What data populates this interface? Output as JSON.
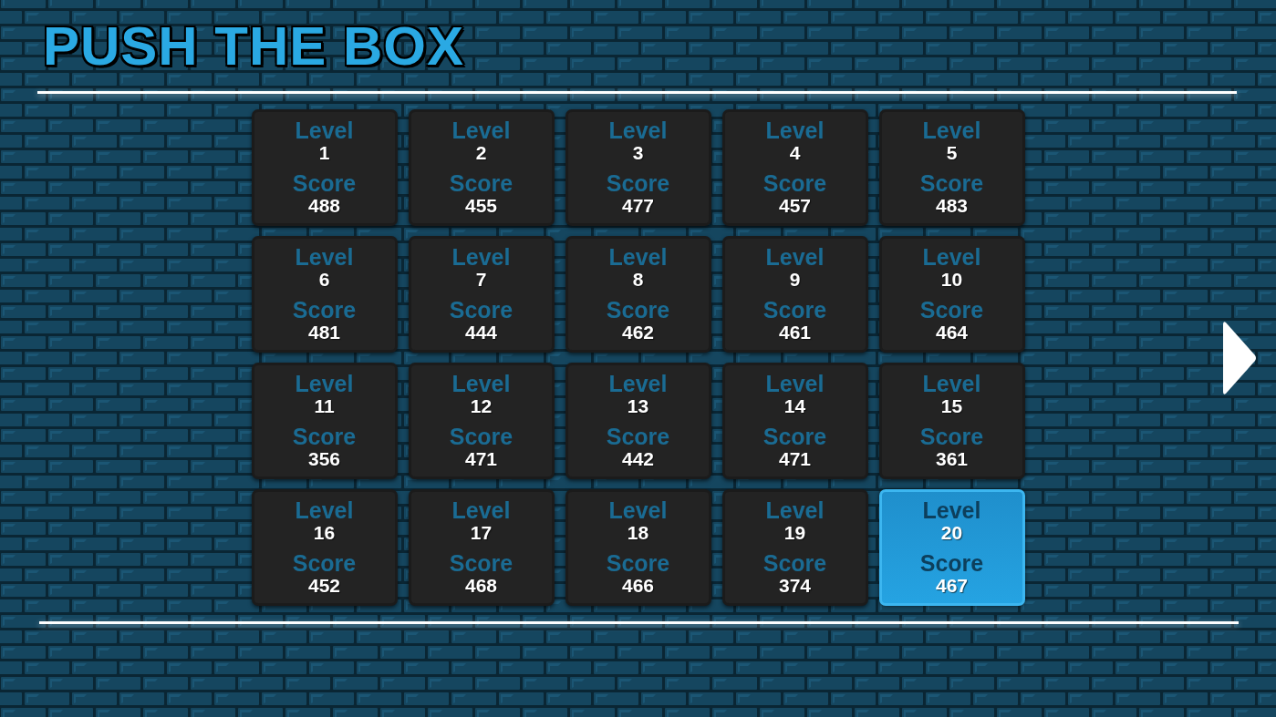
{
  "title": "PUSH THE BOX",
  "levels": [
    {
      "level_label": "Level",
      "level": "1",
      "score_label": "Score",
      "score": "488",
      "selected": false
    },
    {
      "level_label": "Level",
      "level": "2",
      "score_label": "Score",
      "score": "455",
      "selected": false
    },
    {
      "level_label": "Level",
      "level": "3",
      "score_label": "Score",
      "score": "477",
      "selected": false
    },
    {
      "level_label": "Level",
      "level": "4",
      "score_label": "Score",
      "score": "457",
      "selected": false
    },
    {
      "level_label": "Level",
      "level": "5",
      "score_label": "Score",
      "score": "483",
      "selected": false
    },
    {
      "level_label": "Level",
      "level": "6",
      "score_label": "Score",
      "score": "481",
      "selected": false
    },
    {
      "level_label": "Level",
      "level": "7",
      "score_label": "Score",
      "score": "444",
      "selected": false
    },
    {
      "level_label": "Level",
      "level": "8",
      "score_label": "Score",
      "score": "462",
      "selected": false
    },
    {
      "level_label": "Level",
      "level": "9",
      "score_label": "Score",
      "score": "461",
      "selected": false
    },
    {
      "level_label": "Level",
      "level": "10",
      "score_label": "Score",
      "score": "464",
      "selected": false
    },
    {
      "level_label": "Level",
      "level": "11",
      "score_label": "Score",
      "score": "356",
      "selected": false
    },
    {
      "level_label": "Level",
      "level": "12",
      "score_label": "Score",
      "score": "471",
      "selected": false
    },
    {
      "level_label": "Level",
      "level": "13",
      "score_label": "Score",
      "score": "442",
      "selected": false
    },
    {
      "level_label": "Level",
      "level": "14",
      "score_label": "Score",
      "score": "471",
      "selected": false
    },
    {
      "level_label": "Level",
      "level": "15",
      "score_label": "Score",
      "score": "361",
      "selected": false
    },
    {
      "level_label": "Level",
      "level": "16",
      "score_label": "Score",
      "score": "452",
      "selected": false
    },
    {
      "level_label": "Level",
      "level": "17",
      "score_label": "Score",
      "score": "468",
      "selected": false
    },
    {
      "level_label": "Level",
      "level": "18",
      "score_label": "Score",
      "score": "466",
      "selected": false
    },
    {
      "level_label": "Level",
      "level": "19",
      "score_label": "Score",
      "score": "374",
      "selected": false
    },
    {
      "level_label": "Level",
      "level": "20",
      "score_label": "Score",
      "score": "467",
      "selected": true
    }
  ]
}
